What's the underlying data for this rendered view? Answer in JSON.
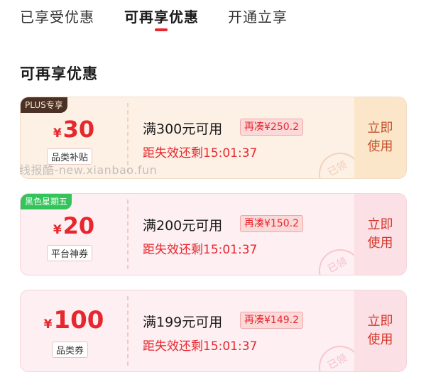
{
  "tabs": [
    {
      "label": "已享受优惠",
      "active": false
    },
    {
      "label": "可再享优惠",
      "active": true
    },
    {
      "label": "开通立享",
      "active": false
    }
  ],
  "section_title": "可再享优惠",
  "coupons": [
    {
      "tag": "PLUS专享",
      "currency": "¥",
      "amount": "30",
      "type": "品类补贴",
      "condition": "满300元可用",
      "add_more": "再凑¥250.2",
      "expire": "距失效还剩15:01:37",
      "stamp": "已领",
      "button_line1": "立即",
      "button_line2": "使用"
    },
    {
      "tag": "黑色星期五",
      "currency": "¥",
      "amount": "20",
      "type": "平台神券",
      "condition": "满200元可用",
      "add_more": "再凑¥150.2",
      "expire": "距失效还剩15:01:37",
      "stamp": "已领",
      "button_line1": "立即",
      "button_line2": "使用"
    },
    {
      "tag": "",
      "currency": "¥",
      "amount": "100",
      "type": "品类券",
      "condition": "满199元可用",
      "add_more": "再凑¥149.2",
      "expire": "距失效还剩15:01:37",
      "stamp": "已领",
      "button_line1": "立即",
      "button_line2": "使用"
    }
  ],
  "watermark": "线报酷-new.xianbao.fun",
  "colors": {
    "accent": "#e8262d",
    "plus_tag": "#4b3125",
    "black_friday_tag": "#35c45a"
  }
}
